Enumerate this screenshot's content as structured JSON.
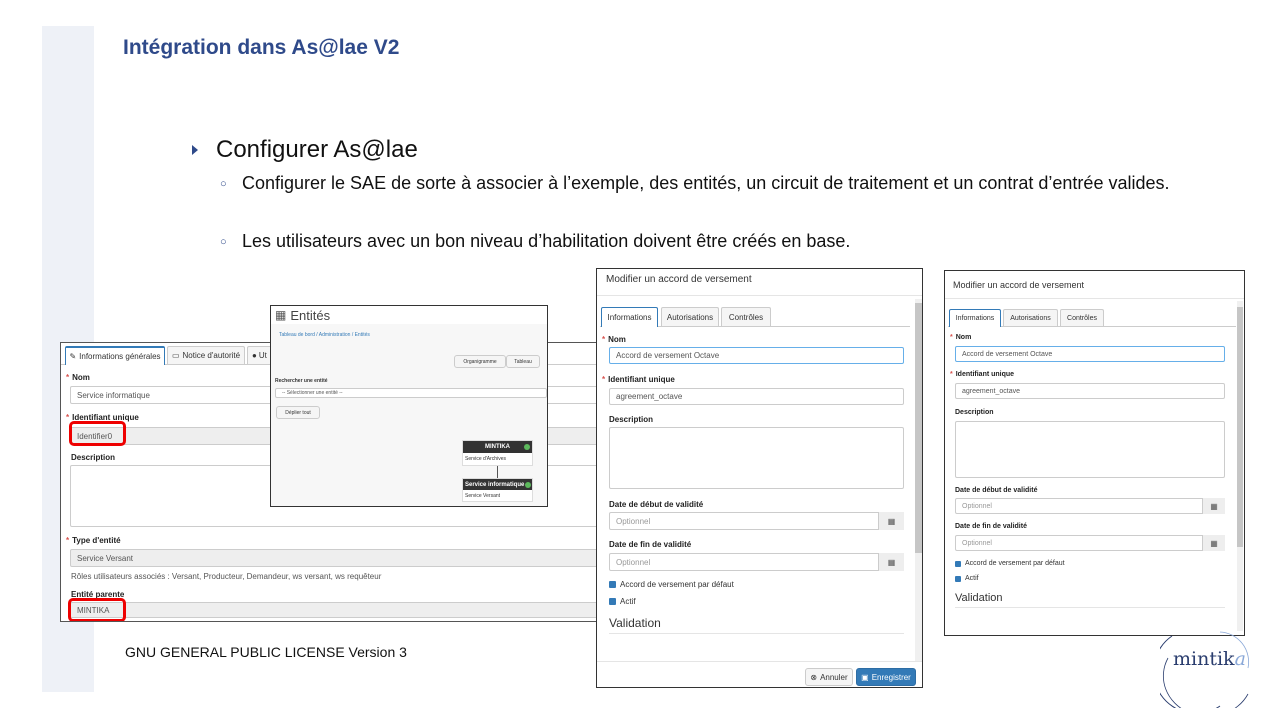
{
  "slide": {
    "title": "Intégration dans As@lae V2",
    "bullet_main": "Configurer As@lae",
    "sub_bullets": [
      "Configurer le SAE de sorte à associer à l’exemple, des entités, un circuit de traitement et un contrat d’entrée valides.",
      "Les utilisateurs avec un bon niveau d’habilitation doivent être créés en base."
    ],
    "footer": "GNU GENERAL PUBLIC LICENSE Version 3",
    "logo_text": "mintik",
    "logo_accent": "a"
  },
  "form_shot": {
    "tabs": [
      "Informations générales",
      "Notice d'autorité",
      "Ut"
    ],
    "nom_label": "Nom",
    "nom_value": "Service informatique",
    "id_label": "Identifiant unique",
    "id_value": "Identifier0",
    "description_label": "Description",
    "type_label": "Type d'entité",
    "type_value": "Service Versant",
    "roles_text": "Rôles utilisateurs associés : Versant, Producteur, Demandeur, ws versant, ws requêteur",
    "parent_label": "Entité parente",
    "parent_value": "MINTIKA"
  },
  "entites_shot": {
    "title": "Entités",
    "breadcrumb": "Tableau de bord  /  Administration  /  Entités",
    "btn_organigramme": "Organigramme",
    "btn_tableau": "Tableau",
    "search_label": "Rechercher une entité",
    "search_placeholder": "-- Sélectionner une entité --",
    "btn_deplier": "Déplier tout",
    "node1_title": "MINTIKA",
    "node1_sub": "Service d'Archives",
    "node2_title": "Service informatique",
    "node2_sub": "Service Versant"
  },
  "accord_shot_1": {
    "title": "Modifier un accord de versement",
    "tabs": [
      "Informations",
      "Autorisations",
      "Contrôles"
    ],
    "nom_label": "Nom",
    "nom_value": "Accord de versement Octave",
    "id_label": "Identifiant unique",
    "id_value": "agreement_octave",
    "description_label": "Description",
    "date_debut_label": "Date de début de validité",
    "date_debut_placeholder": "Optionnel",
    "date_fin_label": "Date de fin de validité",
    "date_fin_placeholder": "Optionnel",
    "chk_defaut": "Accord de versement par défaut",
    "chk_actif": "Actif",
    "validation_heading": "Validation",
    "btn_annuler": "Annuler",
    "btn_enregistrer": "Enregistrer"
  },
  "accord_shot_2": {
    "title": "Modifier un accord de versement",
    "tabs": [
      "Informations",
      "Autorisations",
      "Contrôles"
    ],
    "nom_label": "Nom",
    "nom_value": "Accord de versement Octave",
    "id_label": "Identifiant unique",
    "id_value": "agreement_octave",
    "description_label": "Description",
    "date_debut_label": "Date de début de validité",
    "date_debut_placeholder": "Optionnel",
    "date_fin_label": "Date de fin de validité",
    "date_fin_placeholder": "Optionnel",
    "chk_defaut": "Accord de versement par défaut",
    "chk_actif": "Actif",
    "validation_heading": "Validation"
  },
  "colors": {
    "title_blue": "#2f4a8a",
    "primary": "#337ab7",
    "highlight_red": "#e00000",
    "node_dark": "#333333",
    "node_green": "#5cb85c"
  }
}
